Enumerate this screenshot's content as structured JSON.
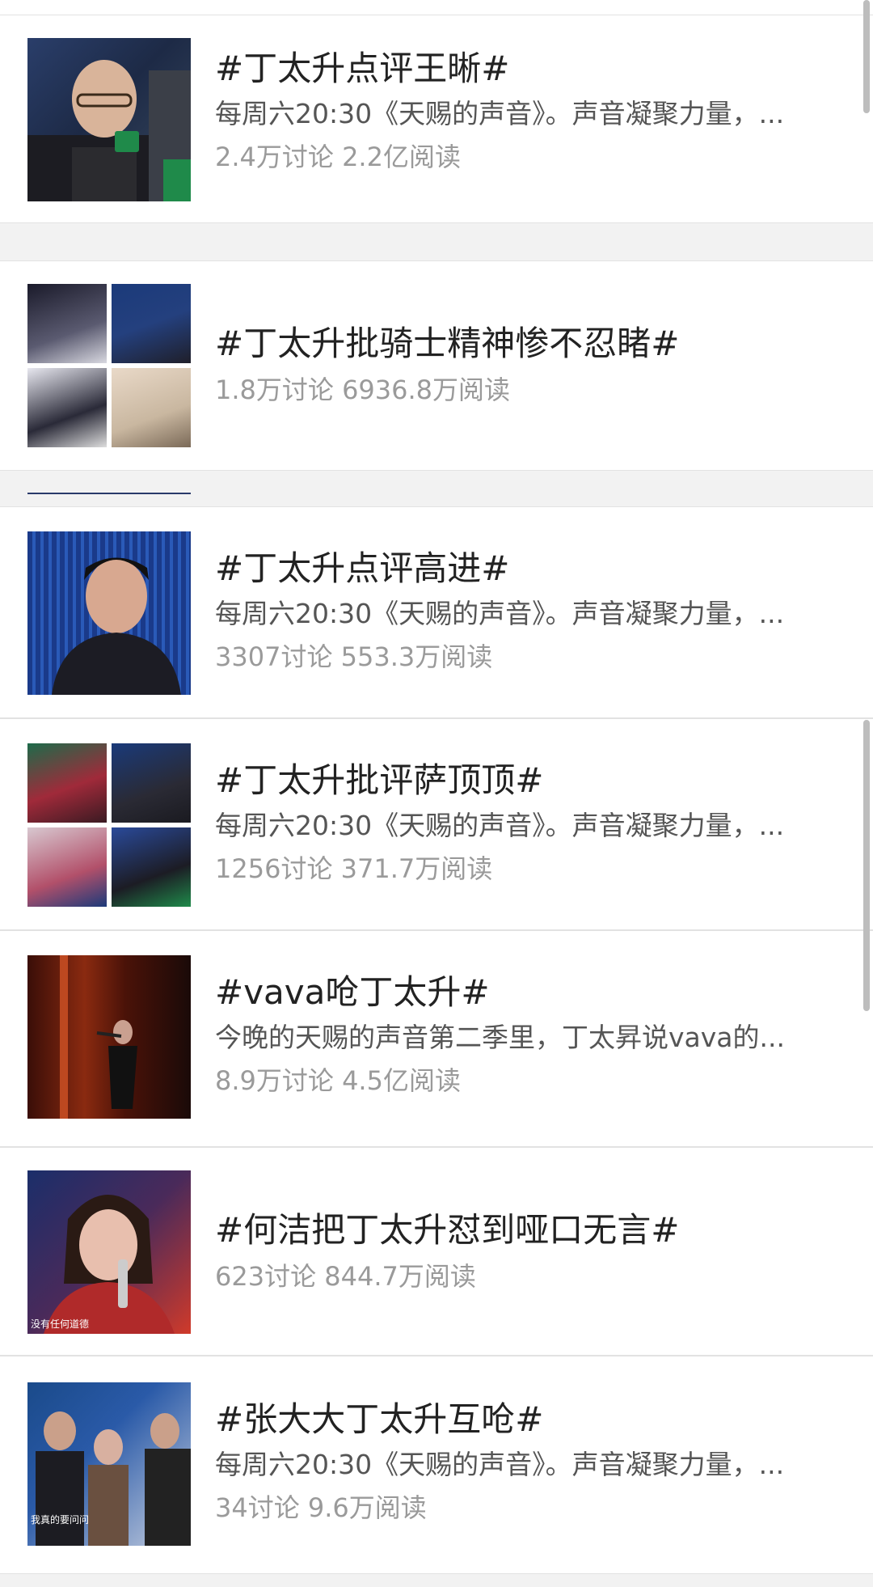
{
  "topics": [
    {
      "title": "#丁太升点评王晰#",
      "desc": "每周六20:30《天赐的声音》。声音凝聚力量，...",
      "stats": "2.4万讨论 2.2亿阅读"
    },
    {
      "title": "#丁太升批骑士精神惨不忍睹#",
      "desc": "",
      "stats": "1.8万讨论 6936.8万阅读"
    },
    {
      "title": "#丁太升点评高进#",
      "desc": "每周六20:30《天赐的声音》。声音凝聚力量，...",
      "stats": "3307讨论 553.3万阅读"
    },
    {
      "title": "#丁太升批评萨顶顶#",
      "desc": "每周六20:30《天赐的声音》。声音凝聚力量，...",
      "stats": "1256讨论 371.7万阅读"
    },
    {
      "title": "#vava呛丁太升#",
      "desc": "今晚的天赐的声音第二季里，丁太昇说vava的...",
      "stats": "8.9万讨论 4.5亿阅读"
    },
    {
      "title": "#何洁把丁太升怼到哑口无言#",
      "desc": "",
      "stats": "623讨论 844.7万阅读"
    },
    {
      "title": "#张大大丁太升互呛#",
      "desc": "每周六20:30《天赐的声音》。声音凝聚力量，...",
      "stats": "34讨论 9.6万阅读"
    }
  ],
  "thumb_captions": {
    "topic6": "没有任何道德",
    "topic7": "我真的要问问"
  },
  "colors": {
    "background": "#f2f2f2",
    "card": "#ffffff",
    "title": "#222222",
    "desc": "#555555",
    "stats": "#9a9a9a",
    "divider": "#e2e2e2"
  }
}
